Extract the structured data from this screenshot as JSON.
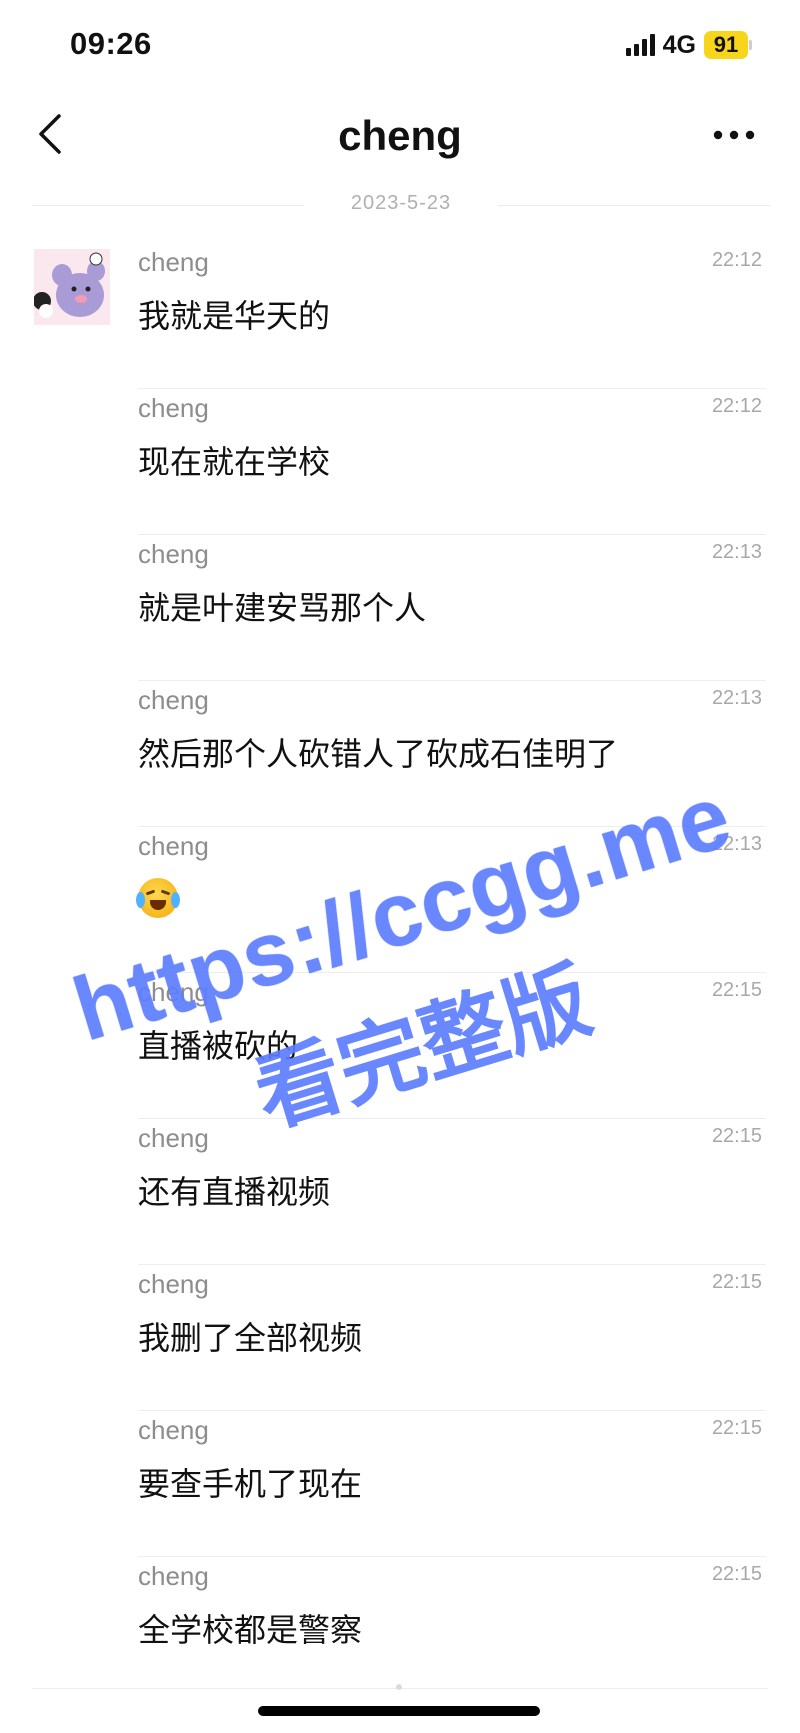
{
  "status_bar": {
    "time": "09:26",
    "network": "4G",
    "battery": "91",
    "battery_color": "#f7d51a"
  },
  "nav": {
    "title": "cheng",
    "back_icon": "chevron-left-icon",
    "more_icon": "ellipsis-icon"
  },
  "date_separator": "2023-5-23",
  "messages": [
    {
      "sender": "cheng",
      "time": "22:12",
      "text": "我就是华天的"
    },
    {
      "sender": "cheng",
      "time": "22:12",
      "text": "现在就在学校"
    },
    {
      "sender": "cheng",
      "time": "22:13",
      "text": "就是叶建安骂那个人"
    },
    {
      "sender": "cheng",
      "time": "22:13",
      "text": "然后那个人砍错人了砍成石佳明了"
    },
    {
      "sender": "cheng",
      "time": "22:13",
      "emoji": "crying-laughing-emoji"
    },
    {
      "sender": "cheng",
      "time": "22:15",
      "text": "直播被砍的"
    },
    {
      "sender": "cheng",
      "time": "22:15",
      "text": "还有直播视频"
    },
    {
      "sender": "cheng",
      "time": "22:15",
      "text": "我删了全部视频"
    },
    {
      "sender": "cheng",
      "time": "22:15",
      "text": "要查手机了现在"
    },
    {
      "sender": "cheng",
      "time": "22:15",
      "text": "全学校都是警察"
    }
  ],
  "watermark": {
    "url": "https://ccgg.me",
    "text": "看完整版",
    "color": "#5d7dff"
  }
}
